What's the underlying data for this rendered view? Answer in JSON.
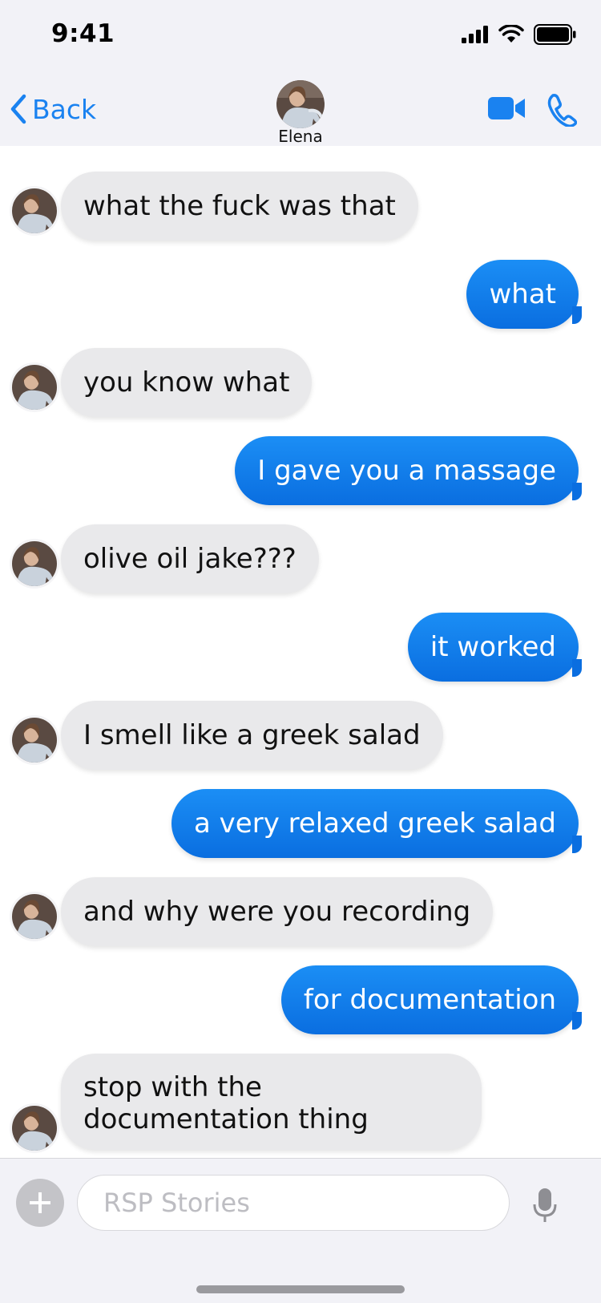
{
  "status_bar": {
    "time": "9:41"
  },
  "nav": {
    "back_label": "Back",
    "contact_name": "Elena"
  },
  "colors": {
    "accent": "#1a82f0",
    "outgoing_bubble": "#0a7ff0",
    "incoming_bubble": "#e9e9eb"
  },
  "messages": [
    {
      "direction": "incoming",
      "text": "what the fuck was that"
    },
    {
      "direction": "outgoing",
      "text": "what"
    },
    {
      "direction": "incoming",
      "text": "you know what"
    },
    {
      "direction": "outgoing",
      "text": "I gave you a massage"
    },
    {
      "direction": "incoming",
      "text": "olive oil jake???"
    },
    {
      "direction": "outgoing",
      "text": "it worked"
    },
    {
      "direction": "incoming",
      "text": "I smell like a greek salad"
    },
    {
      "direction": "outgoing",
      "text": "a very relaxed greek salad"
    },
    {
      "direction": "incoming",
      "text": "and why were you recording"
    },
    {
      "direction": "outgoing",
      "text": "for documentation"
    },
    {
      "direction": "incoming",
      "text": "stop with the documentation thing"
    }
  ],
  "composer": {
    "placeholder": "RSP Stories"
  },
  "icons": {
    "plus": "plus-icon",
    "mic": "microphone-icon",
    "video": "video-camera-icon",
    "phone": "phone-icon",
    "back": "chevron-left-icon"
  }
}
